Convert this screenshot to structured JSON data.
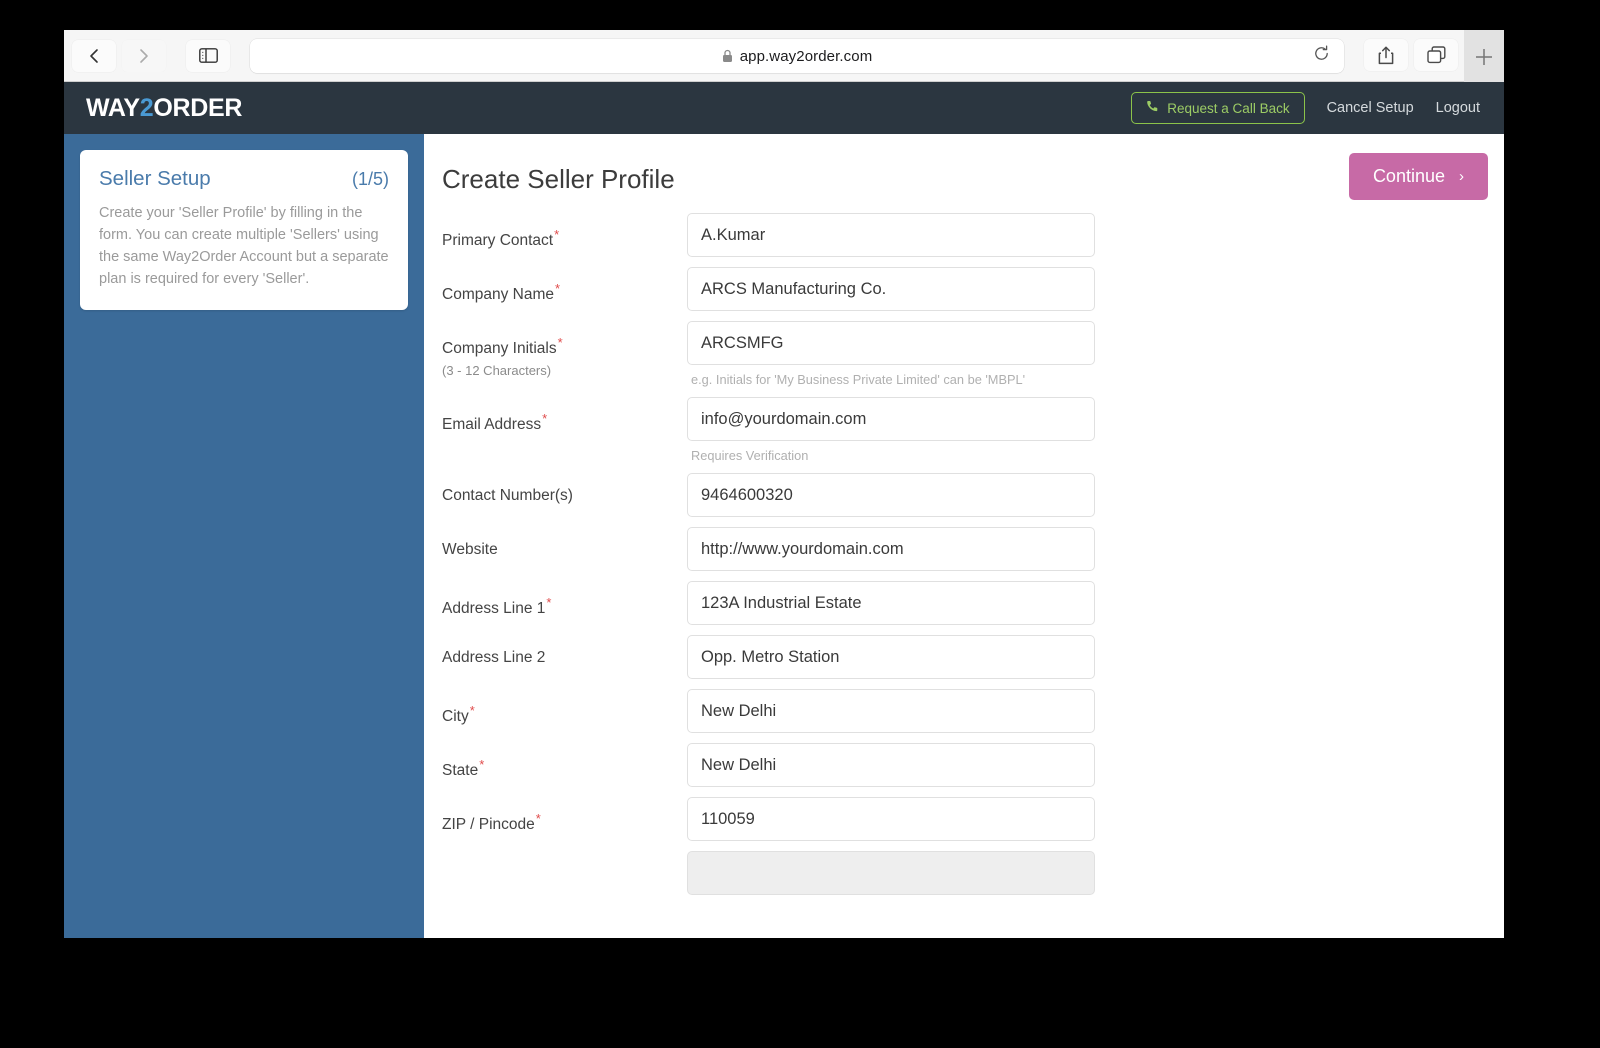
{
  "browser": {
    "back_icon": "chevron-left-icon",
    "forward_icon": "chevron-right-icon",
    "sidebar_icon": "sidebar-toggle-icon",
    "reader_icon": "reader-view-icon",
    "lock_icon": "lock-icon",
    "url": "app.way2order.com",
    "reload_icon": "reload-icon",
    "share_icon": "share-icon",
    "tabs_icon": "tabs-overview-icon",
    "newtab_label": "+"
  },
  "header": {
    "logo_prefix": "WAY",
    "logo_number": "2",
    "logo_suffix": "ORDER",
    "callback_icon": "phone-icon",
    "callback_label": "Request a Call Back",
    "cancel_label": "Cancel Setup",
    "logout_label": "Logout",
    "bg_color": "#2b3640",
    "accent_color": "#4a9ad4",
    "callback_border_color": "#8bc34a"
  },
  "sidebar": {
    "bg_color": "#3b6b99",
    "title": "Seller Setup",
    "step": "(1/5)",
    "description": "Create your 'Seller Profile' by filling in the form. You can create multiple 'Sellers' using the same Way2Order Account but a separate plan is required for every 'Seller'."
  },
  "main": {
    "page_title": "Create Seller Profile",
    "continue_label": "Continue",
    "continue_chevron": "›",
    "continue_color": "#c76aa6"
  },
  "form": {
    "fields": [
      {
        "label": "Primary Contact",
        "required": true,
        "sublabel": "",
        "value": "A.Kumar",
        "placeholder": "",
        "hint": "",
        "name": "primary-contact"
      },
      {
        "label": "Company Name",
        "required": true,
        "sublabel": "",
        "value": "ARCS Manufacturing Co.",
        "placeholder": "",
        "hint": "",
        "name": "company-name"
      },
      {
        "label": "Company Initials",
        "required": true,
        "sublabel": "(3 - 12 Characters)",
        "value": "ARCSMFG",
        "placeholder": "",
        "hint": "e.g. Initials for 'My Business Private Limited' can be 'MBPL'",
        "name": "company-initials"
      },
      {
        "label": "Email Address",
        "required": true,
        "sublabel": "",
        "value": "info@yourdomain.com",
        "placeholder": "",
        "hint": "Requires Verification",
        "name": "email-address"
      },
      {
        "label": "Contact Number(s)",
        "required": false,
        "sublabel": "",
        "value": "9464600320",
        "placeholder": "",
        "hint": "",
        "name": "contact-number"
      },
      {
        "label": "Website",
        "required": false,
        "sublabel": "",
        "value": "http://www.yourdomain.com",
        "placeholder": "",
        "hint": "",
        "name": "website"
      },
      {
        "label": "Address Line 1",
        "required": true,
        "sublabel": "",
        "value": "123A Industrial Estate",
        "placeholder": "",
        "hint": "",
        "name": "address-line-1"
      },
      {
        "label": "Address Line 2",
        "required": false,
        "sublabel": "",
        "value": "Opp. Metro Station",
        "placeholder": "",
        "hint": "",
        "name": "address-line-2"
      },
      {
        "label": "City",
        "required": true,
        "sublabel": "",
        "value": "New Delhi",
        "placeholder": "",
        "hint": "",
        "name": "city"
      },
      {
        "label": "State",
        "required": true,
        "sublabel": "",
        "value": "New Delhi",
        "placeholder": "",
        "hint": "",
        "name": "state"
      },
      {
        "label": "ZIP / Pincode",
        "required": true,
        "sublabel": "",
        "value": "110059",
        "placeholder": "",
        "hint": "",
        "name": "zip-pincode"
      }
    ]
  }
}
